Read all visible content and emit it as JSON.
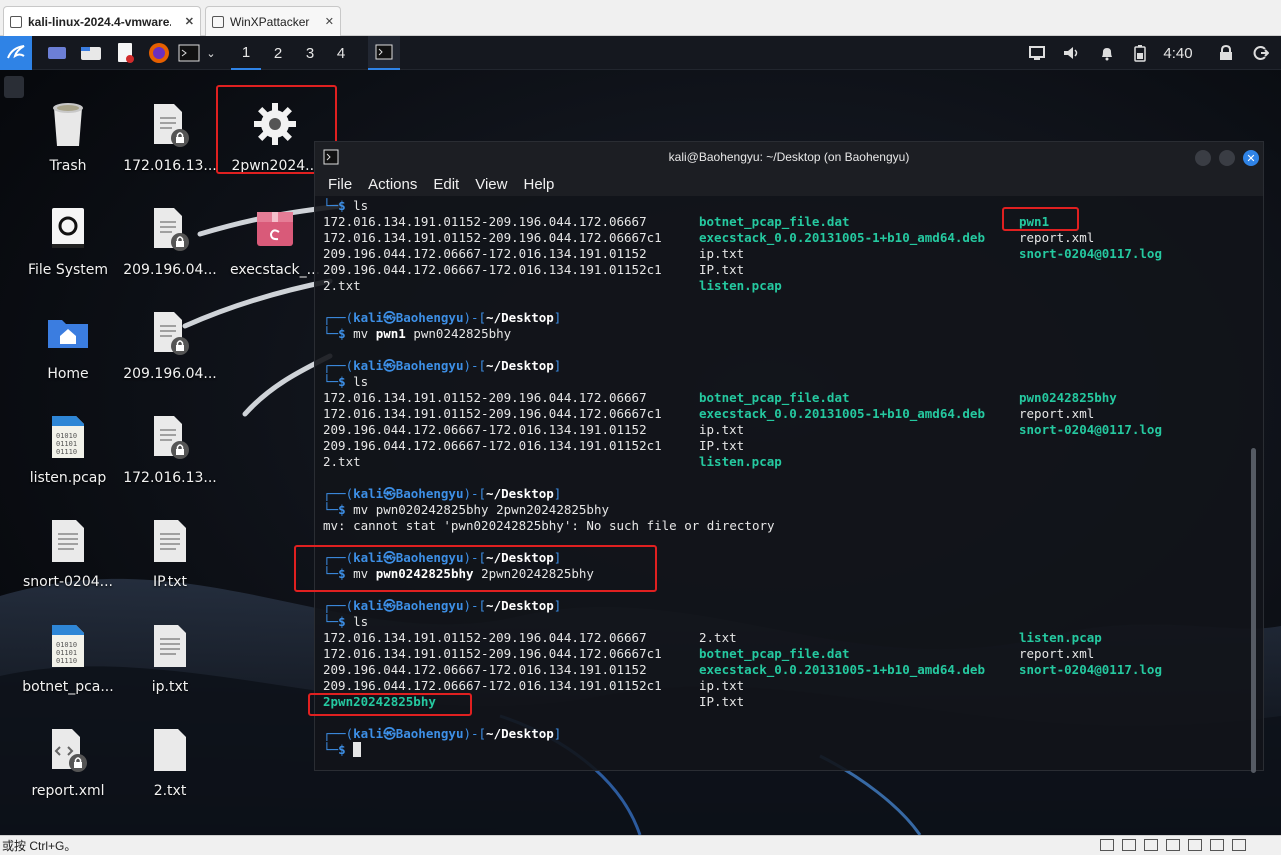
{
  "vm_tabs": [
    {
      "label": "kali-linux-2024.4-vmware...",
      "close": "✕"
    },
    {
      "label": "WinXPattacker",
      "close": "✕"
    }
  ],
  "panel": {
    "workspaces": [
      "1",
      "2",
      "3",
      "4"
    ],
    "clock": "4:40"
  },
  "desktop_icons": [
    {
      "label": "Trash",
      "icon": "trash-icon"
    },
    {
      "label": "172.016.13...",
      "icon": "locked-text-file-icon"
    },
    {
      "label": "2pwn2024...",
      "icon": "gear-file-icon"
    },
    {
      "label": "File System",
      "icon": "drive-icon"
    },
    {
      "label": "209.196.04...",
      "icon": "locked-text-file-icon"
    },
    {
      "label": "execstack_...",
      "icon": "deb-package-icon"
    },
    {
      "label": "Home",
      "icon": "home-folder-icon"
    },
    {
      "label": "209.196.04...",
      "icon": "locked-text-file-icon"
    },
    {
      "label": "listen.pcap",
      "icon": "binary-file-icon"
    },
    {
      "label": "172.016.13...",
      "icon": "locked-text-file-icon"
    },
    {
      "label": "snort-0204...",
      "icon": "text-file-icon"
    },
    {
      "label": "IP.txt",
      "icon": "text-file-icon"
    },
    {
      "label": "botnet_pca...",
      "icon": "binary-file-icon"
    },
    {
      "label": "ip.txt",
      "icon": "text-file-icon"
    },
    {
      "label": "report.xml",
      "icon": "locked-xml-file-icon"
    },
    {
      "label": "2.txt",
      "icon": "text-file-icon"
    }
  ],
  "terminal": {
    "title": "kali@Baohengyu: ~/Desktop (on Baohengyu)",
    "menu": [
      "File",
      "Actions",
      "Edit",
      "View",
      "Help"
    ],
    "prompt": {
      "open": "┌──(",
      "user": "kali",
      "at": "㉿",
      "host": "Baohengyu",
      "mid": ")-[",
      "path": "~/Desktop",
      "close": "]",
      "arrow": "└─",
      "dollar": "$"
    },
    "ls1": [
      [
        "172.016.134.191.01152-209.196.044.172.06667",
        "botnet_pcap_file.dat",
        "pwn1"
      ],
      [
        "172.016.134.191.01152-209.196.044.172.06667c1",
        "execstack_0.0.20131005-1+b10_amd64.deb",
        "report.xml"
      ],
      [
        "209.196.044.172.06667-172.016.134.191.01152",
        "ip.txt",
        "snort-0204@0117.log"
      ],
      [
        "209.196.044.172.06667-172.016.134.191.01152c1",
        "IP.txt",
        ""
      ],
      [
        "2.txt",
        "listen.pcap",
        ""
      ]
    ],
    "cmd_ls": "ls",
    "cmd_mv1": {
      "mv": "mv",
      "src": "pwn1",
      "dst": "pwn0242825bhy"
    },
    "ls2": [
      [
        "172.016.134.191.01152-209.196.044.172.06667",
        "botnet_pcap_file.dat",
        "pwn0242825bhy"
      ],
      [
        "172.016.134.191.01152-209.196.044.172.06667c1",
        "execstack_0.0.20131005-1+b10_amd64.deb",
        "report.xml"
      ],
      [
        "209.196.044.172.06667-172.016.134.191.01152",
        "ip.txt",
        "snort-0204@0117.log"
      ],
      [
        "209.196.044.172.06667-172.016.134.191.01152c1",
        "IP.txt",
        ""
      ],
      [
        "2.txt",
        "listen.pcap",
        ""
      ]
    ],
    "cmd_mv2": {
      "mv": "mv",
      "src": "pwn020242825bhy",
      "dst": "2pwn20242825bhy"
    },
    "error": "mv: cannot stat 'pwn020242825bhy': No such file or directory",
    "cmd_mv3": {
      "mv": "mv",
      "src": "pwn0242825bhy",
      "dst": "2pwn20242825bhy"
    },
    "ls3": [
      [
        "172.016.134.191.01152-209.196.044.172.06667",
        "2.txt",
        "listen.pcap"
      ],
      [
        "172.016.134.191.01152-209.196.044.172.06667c1",
        "botnet_pcap_file.dat",
        "report.xml"
      ],
      [
        "209.196.044.172.06667-172.016.134.191.01152",
        "execstack_0.0.20131005-1+b10_amd64.deb",
        "snort-0204@0117.log"
      ],
      [
        "209.196.044.172.06667-172.016.134.191.01152c1",
        "ip.txt",
        ""
      ],
      [
        "2pwn20242825bhy",
        "IP.txt",
        ""
      ]
    ]
  },
  "statusbar": {
    "text": "或按 Ctrl+G。"
  },
  "colors": {
    "accent": "#2f83e6",
    "terminal_green": "#25c9a0",
    "prompt_blue": "#3d8fe6",
    "highlight_red": "#e02020"
  }
}
